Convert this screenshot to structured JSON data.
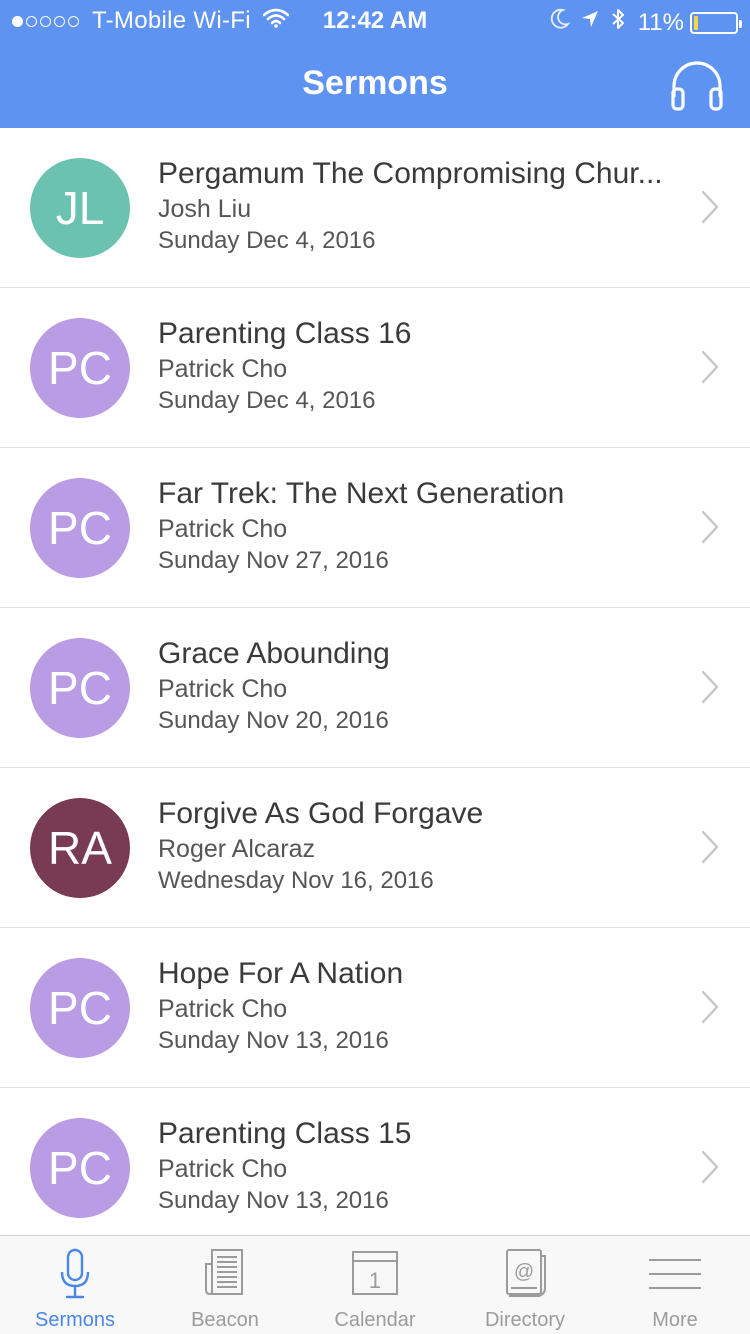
{
  "status_bar": {
    "carrier": "T-Mobile Wi-Fi",
    "time": "12:42 AM",
    "battery": "11%",
    "battery_fraction": 0.11
  },
  "nav": {
    "title": "Sermons",
    "action_icon": "headphones-icon"
  },
  "colors": {
    "header": "#5f93f1",
    "avatar_jl": "#6cc2b0",
    "avatar_pc": "#b99ce3",
    "avatar_ra": "#783b53",
    "tab_active": "#4a86e8",
    "tab_inactive": "#9b9b9b"
  },
  "sermons": [
    {
      "initials": "JL",
      "title": "Pergamum The Compromising Chur...",
      "speaker": "Josh Liu",
      "date": "Sunday Dec 4, 2016",
      "color": "#6cc2b0"
    },
    {
      "initials": "PC",
      "title": "Parenting Class 16",
      "speaker": "Patrick Cho",
      "date": "Sunday Dec 4, 2016",
      "color": "#b99ce3"
    },
    {
      "initials": "PC",
      "title": "Far Trek: The Next Generation",
      "speaker": "Patrick Cho",
      "date": "Sunday Nov 27, 2016",
      "color": "#b99ce3"
    },
    {
      "initials": "PC",
      "title": "Grace Abounding",
      "speaker": "Patrick Cho",
      "date": "Sunday Nov 20, 2016",
      "color": "#b99ce3"
    },
    {
      "initials": "RA",
      "title": "Forgive As God Forgave",
      "speaker": "Roger Alcaraz",
      "date": "Wednesday Nov 16, 2016",
      "color": "#783b53"
    },
    {
      "initials": "PC",
      "title": "Hope For A Nation",
      "speaker": "Patrick Cho",
      "date": "Sunday Nov 13, 2016",
      "color": "#b99ce3"
    },
    {
      "initials": "PC",
      "title": "Parenting Class 15",
      "speaker": "Patrick Cho",
      "date": "Sunday Nov 13, 2016",
      "color": "#b99ce3"
    }
  ],
  "tabs": [
    {
      "label": "Sermons",
      "icon": "microphone-icon",
      "active": true
    },
    {
      "label": "Beacon",
      "icon": "newspaper-icon",
      "active": false
    },
    {
      "label": "Calendar",
      "icon": "calendar-icon",
      "active": false
    },
    {
      "label": "Directory",
      "icon": "address-book-icon",
      "active": false
    },
    {
      "label": "More",
      "icon": "menu-icon",
      "active": false
    }
  ]
}
